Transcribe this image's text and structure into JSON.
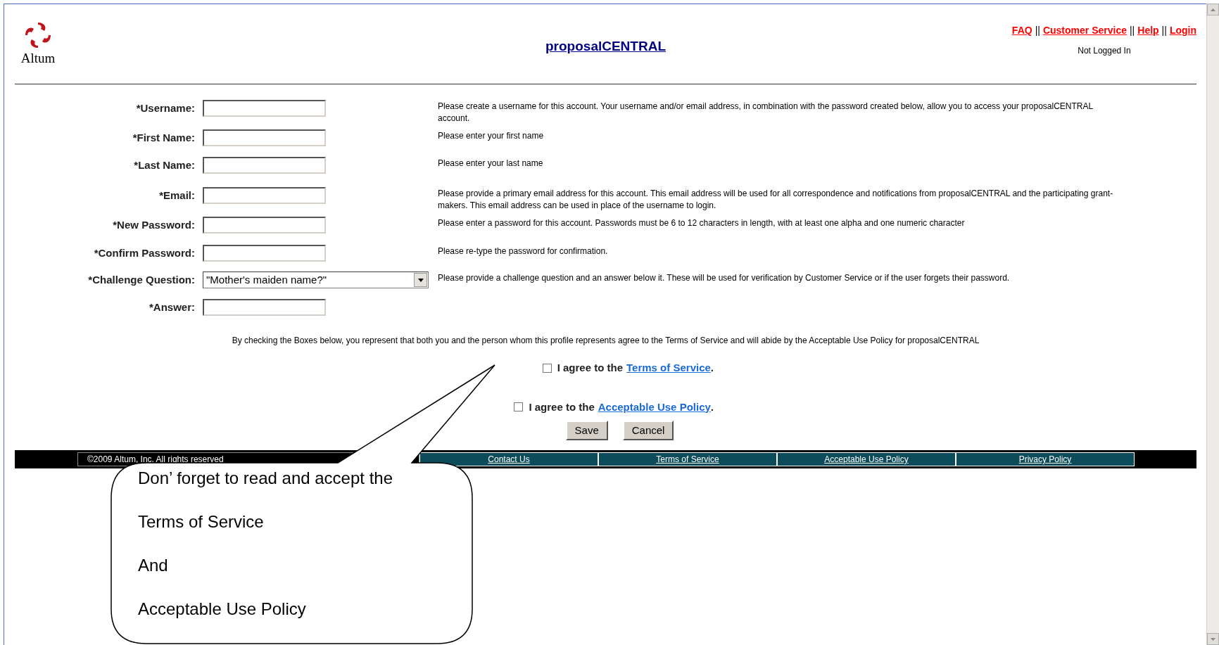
{
  "header": {
    "logo_text": "Altum",
    "title": "proposalCENTRAL",
    "links": [
      "FAQ",
      "Customer Service",
      "Help",
      "Login"
    ],
    "separator": "||",
    "login_status": "Not Logged In"
  },
  "form": {
    "fields": [
      {
        "kind": "text",
        "label": "*Username:",
        "description": "Please create a username for this account. Your username and/or email address, in combination with the password created below, allow you to access your proposalCENTRAL account."
      },
      {
        "kind": "text",
        "label": "*First Name:",
        "description": "Please enter your first name"
      },
      {
        "kind": "text",
        "label": "*Last Name:",
        "description": "Please enter your last name"
      },
      {
        "kind": "text",
        "label": "*Email:",
        "description": "Please provide a primary email address for this account. This email address will be used for all correspondence and notifications from proposalCENTRAL and the participating grant-makers. This email address can be used in place of the username to login."
      },
      {
        "kind": "text",
        "label": "*New Password:",
        "description": "Please enter a password for this account. Passwords must be 6 to 12 characters in length, with at least one alpha and one numeric character"
      },
      {
        "kind": "text",
        "label": "*Confirm Password:",
        "description": "Please re-type the password for confirmation."
      },
      {
        "kind": "select",
        "label": "*Challenge Question:",
        "value": "\"Mother's maiden name?\"",
        "description": "Please provide a challenge question and an answer below it. These will be used for verification by Customer Service or if the user forgets their password."
      },
      {
        "kind": "text",
        "label": "*Answer:"
      }
    ],
    "consent_note": "By checking the Boxes below, you represent that both you and the person whom this profile represents agree to the Terms of Service and will abide by the Acceptable Use Policy for proposalCENTRAL",
    "agreements": [
      {
        "prefix": "I agree to the",
        "link": "Terms of Service",
        "suffix": ".",
        "checked": false
      },
      {
        "prefix": "I agree to the",
        "link": "Acceptable Use Policy",
        "suffix": ".",
        "checked": false
      }
    ],
    "buttons": [
      "Save",
      "Cancel"
    ]
  },
  "footer": {
    "copyright": "©2009 Altum, Inc. All rights reserved",
    "links": [
      "Contact Us",
      "Terms of Service",
      "Acceptable Use Policy",
      "Privacy Policy"
    ]
  },
  "callout": {
    "lines": [
      "Don’ forget to read and accept the",
      "Terms of Service",
      "And",
      "Acceptable Use Policy"
    ]
  }
}
